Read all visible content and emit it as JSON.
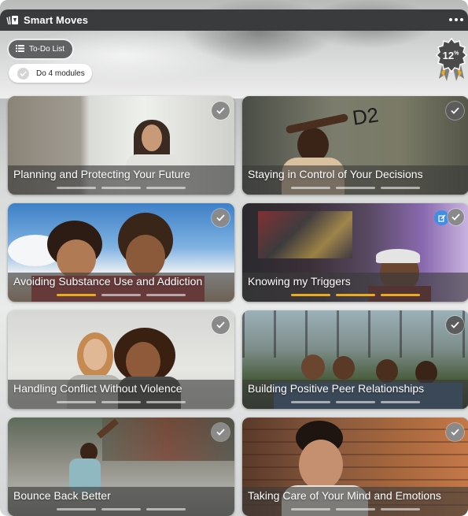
{
  "app": {
    "title": "Smart Moves"
  },
  "todo": {
    "label": "To-Do List"
  },
  "task": {
    "label": "Do 4 modules"
  },
  "badge": {
    "value": "12",
    "suffix": "%"
  },
  "modules": [
    {
      "title": "Planning and Protecting Your Future",
      "progress_segments_complete": 0
    },
    {
      "title": "Staying in Control of Your Decisions",
      "progress_segments_complete": 0
    },
    {
      "title": "Avoiding Substance Use and Addiction",
      "progress_segments_complete": 1
    },
    {
      "title": "Knowing my Triggers",
      "progress_segments_complete": 3
    },
    {
      "title": "Handling Conflict Without Violence",
      "progress_segments_complete": 0
    },
    {
      "title": "Building Positive Peer Relationships",
      "progress_segments_complete": 0
    },
    {
      "title": "Bounce Back Better",
      "progress_segments_complete": 0
    },
    {
      "title": "Taking Care of Your Mind and Emotions",
      "progress_segments_complete": 0
    }
  ],
  "colors": {
    "titlebar": "#3a3b3d",
    "progress_done": "#e8ad1f",
    "edit_badge": "#3e8ee6"
  }
}
